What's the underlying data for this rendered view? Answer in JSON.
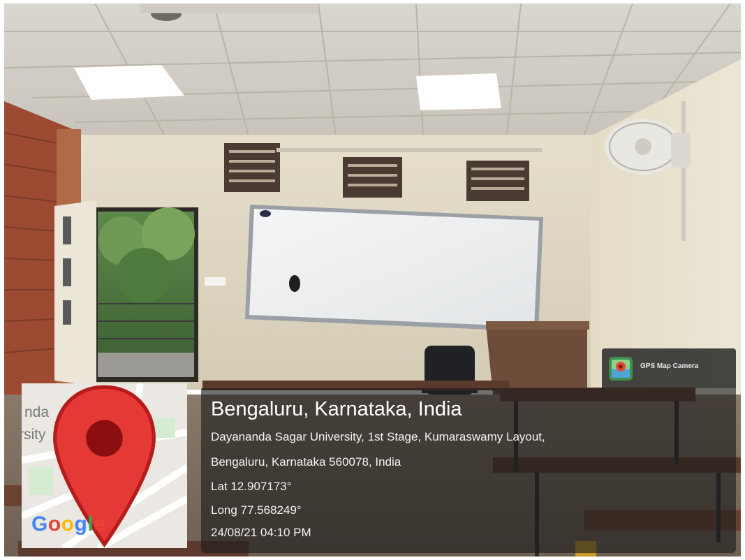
{
  "photo": {
    "scene": "classroom-with-whiteboard"
  },
  "gps_badge": {
    "app_name": "GPS Map Camera",
    "icon": "gps-map-camera-app-icon"
  },
  "location": {
    "city_line": "Bengaluru, Karnataka, India",
    "address_line1": "Dayananda Sagar University, 1st Stage, Kumaraswamy Layout,",
    "address_line2": "Bengaluru, Karnataka 560078, India",
    "latitude": "Lat 12.907173°",
    "longitude": "Long 77.568249°",
    "timestamp": "24/08/21 04:10 PM"
  },
  "map": {
    "label_fragment1": "nda",
    "label_fragment2": "rsity",
    "pin_icon": "map-pin-icon",
    "logo_text": "Google",
    "logo_colors": [
      "#4285F4",
      "#EA4335",
      "#FBBC05",
      "#4285F4",
      "#34A853",
      "#EA4335"
    ]
  }
}
